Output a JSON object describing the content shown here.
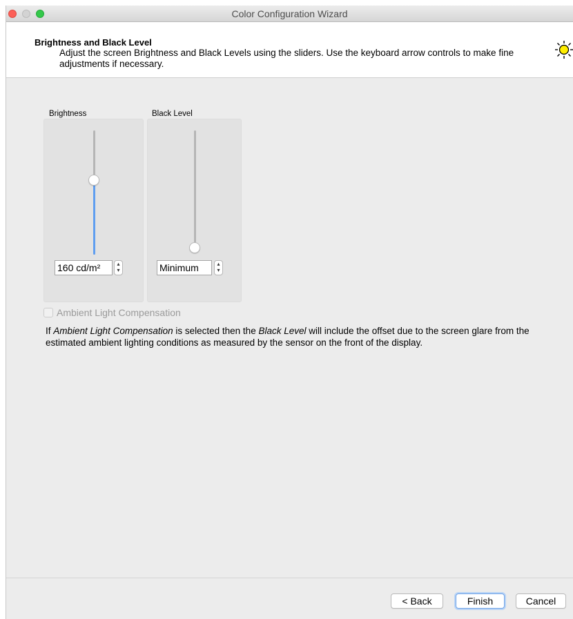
{
  "window": {
    "title": "Color Configuration Wizard"
  },
  "header": {
    "title": "Brightness and Black Level",
    "description": "Adjust the screen Brightness and Black Levels using the sliders. Use the keyboard arrow controls to make fine adjustments if necessary.",
    "icon": "sun-icon"
  },
  "brightness": {
    "label": "Brightness",
    "value": "160 cd/m²",
    "slider_level": 0.6
  },
  "black_level": {
    "label": "Black Level",
    "value": "Minimum",
    "slider_level": 0.0
  },
  "ambient": {
    "label": "Ambient Light Compensation",
    "checked": false,
    "enabled": false
  },
  "info": {
    "part1": "If ",
    "em1": "Ambient Light Compensation",
    "part2": " is selected then the ",
    "em2": "Black Level",
    "part3": " will include the offset due to the screen glare from the estimated ambient lighting conditions as measured by the sensor on the front of the display."
  },
  "buttons": {
    "back": "< Back",
    "finish": "Finish",
    "cancel": "Cancel"
  },
  "colors": {
    "accent": "#5f9ef0",
    "sun": "#ffee00"
  }
}
